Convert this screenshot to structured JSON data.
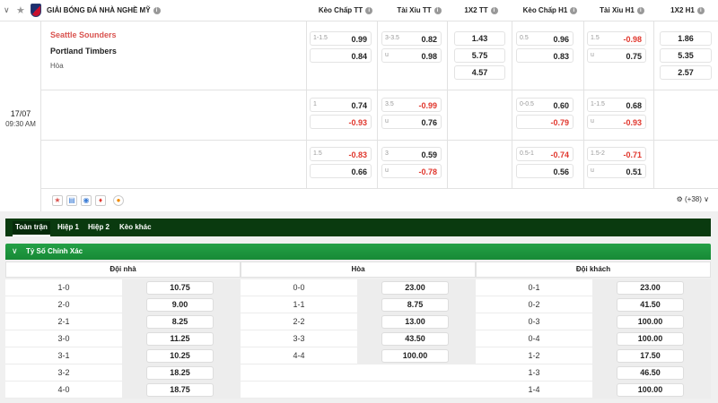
{
  "header": {
    "league": "GIẢI BÓNG ĐÁ NHÀ NGHỀ MỸ",
    "columns": [
      "Kèo Chấp TT",
      "Tài Xỉu TT",
      "1X2 TT",
      "Kèo Chấp H1",
      "Tài Xỉu H1",
      "1X2 H1"
    ]
  },
  "match": {
    "date": "17/07",
    "time": "09:30 AM",
    "home": "Seattle Sounders",
    "away": "Portland Timbers",
    "draw": "Hòa",
    "more": "(+38)"
  },
  "odds_rows": [
    {
      "hc_tt": {
        "h": "1-1.5",
        "a": "0.99",
        "b": "0.84",
        "a_red": false,
        "b_red": false
      },
      "ou_tt": {
        "h": "3-3.5",
        "u": "u",
        "a": "0.82",
        "b": "0.98",
        "a_red": false,
        "b_red": false
      },
      "x12_tt": [
        "1.43",
        "5.75",
        "4.57"
      ],
      "hc_h1": {
        "h": "0.5",
        "a": "0.96",
        "b": "0.83",
        "a_red": false,
        "b_red": false
      },
      "ou_h1": {
        "h": "1.5",
        "u": "u",
        "a": "-0.98",
        "b": "0.75",
        "a_red": true,
        "b_red": false
      },
      "x12_h1": [
        "1.86",
        "5.35",
        "2.57"
      ]
    },
    {
      "hc_tt": {
        "h": "1",
        "a": "0.74",
        "b": "-0.93",
        "a_red": false,
        "b_red": true
      },
      "ou_tt": {
        "h": "3.5",
        "u": "u",
        "a": "-0.99",
        "b": "0.76",
        "a_red": true,
        "b_red": false
      },
      "hc_h1": {
        "h": "0-0.5",
        "a": "0.60",
        "b": "-0.79",
        "a_red": false,
        "b_red": true
      },
      "ou_h1": {
        "h": "1-1.5",
        "u": "u",
        "a": "0.68",
        "b": "-0.93",
        "a_red": false,
        "b_red": true
      }
    },
    {
      "hc_tt": {
        "h": "1.5",
        "a": "-0.83",
        "b": "0.66",
        "a_red": true,
        "b_red": false
      },
      "ou_tt": {
        "h": "3",
        "u": "u",
        "a": "0.59",
        "b": "-0.78",
        "a_red": false,
        "b_red": true
      },
      "hc_h1": {
        "h": "0.5-1",
        "a": "-0.74",
        "b": "0.56",
        "a_red": true,
        "b_red": false
      },
      "ou_h1": {
        "h": "1.5-2",
        "u": "u",
        "a": "-0.71",
        "b": "0.51",
        "a_red": true,
        "b_red": false
      }
    }
  ],
  "tabs": [
    "Toàn trận",
    "Hiệp 1",
    "Hiệp 2",
    "Kèo khác"
  ],
  "section_title": "Tỷ Số Chính Xác",
  "correct_score": {
    "headers": [
      "Đội nhà",
      "Hòa",
      "Đội khách"
    ],
    "home": [
      [
        "1-0",
        "10.75"
      ],
      [
        "2-0",
        "9.00"
      ],
      [
        "2-1",
        "8.25"
      ],
      [
        "3-0",
        "11.25"
      ],
      [
        "3-1",
        "10.25"
      ],
      [
        "3-2",
        "18.25"
      ],
      [
        "4-0",
        "18.75"
      ]
    ],
    "draw": [
      [
        "0-0",
        "23.00"
      ],
      [
        "1-1",
        "8.75"
      ],
      [
        "2-2",
        "13.00"
      ],
      [
        "3-3",
        "43.50"
      ],
      [
        "4-4",
        "100.00"
      ]
    ],
    "away": [
      [
        "0-1",
        "23.00"
      ],
      [
        "0-2",
        "41.50"
      ],
      [
        "0-3",
        "100.00"
      ],
      [
        "0-4",
        "100.00"
      ],
      [
        "1-2",
        "17.50"
      ],
      [
        "1-3",
        "46.50"
      ],
      [
        "1-4",
        "100.00"
      ]
    ]
  },
  "colors": {
    "accent_green": "#178a36",
    "dark_green": "#0a3a0f",
    "red": "#e0362c"
  }
}
